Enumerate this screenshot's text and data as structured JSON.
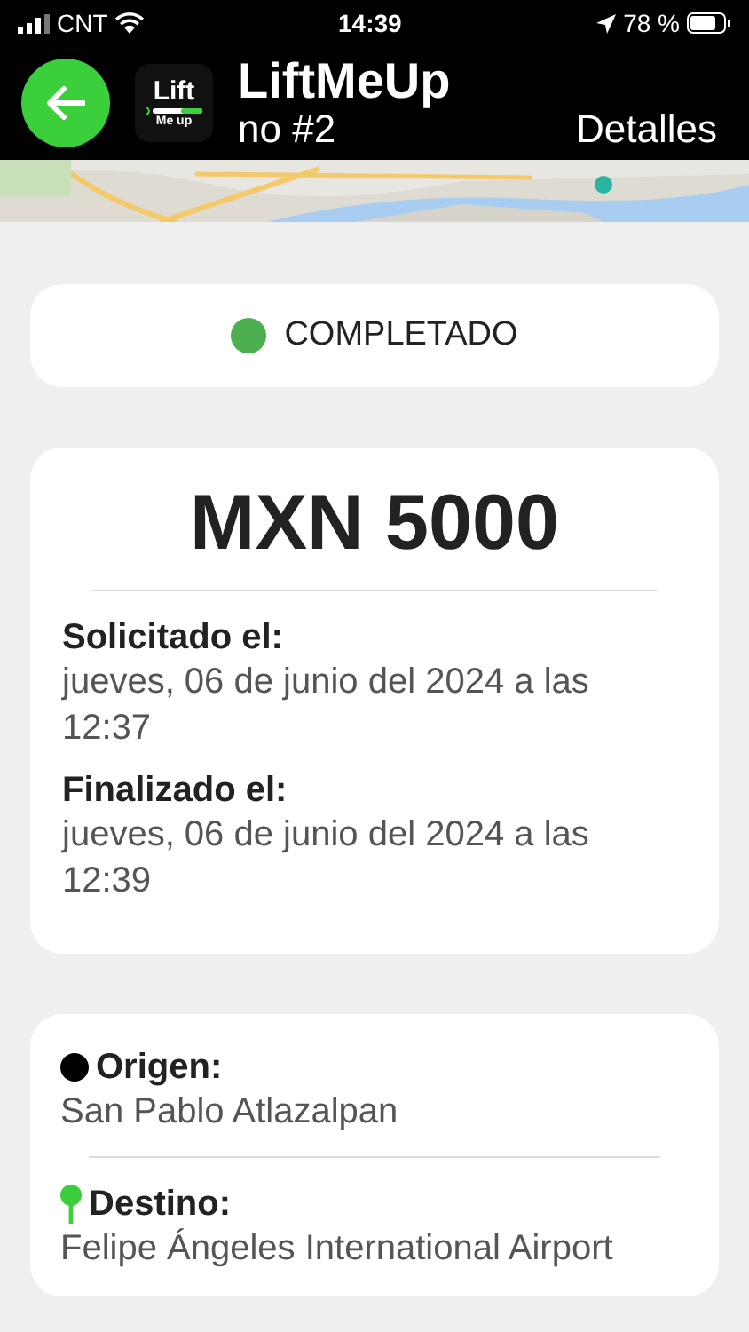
{
  "status_bar": {
    "carrier": "CNT",
    "time": "14:39",
    "battery": "78 %"
  },
  "header": {
    "title": "LiftMeUp",
    "logo_top": "Lift",
    "logo_bottom": "Me up",
    "subtitle": [
      "no #2",
      "Detalles"
    ]
  },
  "status": {
    "label": "COMPLETADO",
    "color": "#4caf50"
  },
  "fare": {
    "amount": "MXN 5000",
    "entries": [
      {
        "label": "Solicitado el:",
        "value": "jueves, 06 de junio del 2024 a las 12:37"
      },
      {
        "label": "Finalizado el:",
        "value": "jueves, 06 de junio del 2024 a las 12:39"
      }
    ]
  },
  "route": [
    {
      "kind": "origin",
      "label": "Origen:",
      "place": "San Pablo Atlazalpan"
    },
    {
      "kind": "destination",
      "label": "Destino:",
      "place": "Felipe Ángeles International Airport"
    }
  ]
}
